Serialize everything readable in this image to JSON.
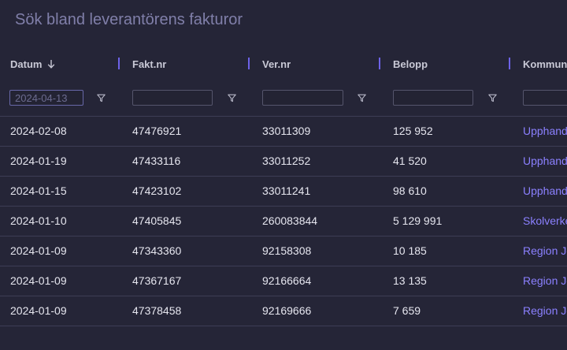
{
  "search": {
    "title": "Sök bland leverantörens fakturor"
  },
  "columns": [
    {
      "label": "Datum",
      "sorted": "descending"
    },
    {
      "label": "Fakt.nr"
    },
    {
      "label": "Ver.nr"
    },
    {
      "label": "Belopp"
    },
    {
      "label": "Kommun"
    }
  ],
  "filters": {
    "datum_value": "2024-04-13",
    "faktnr_value": "",
    "vernr_value": "",
    "belopp_value": "",
    "kommun_value": ""
  },
  "rows": [
    {
      "datum": "2024-02-08",
      "faktnr": "47476921",
      "vernr": "33011309",
      "belopp": "125 952",
      "kommun": "Upphandlingsmyndigheten"
    },
    {
      "datum": "2024-01-19",
      "faktnr": "47433116",
      "vernr": "33011252",
      "belopp": "41 520",
      "kommun": "Upphandlingsmyndigheten"
    },
    {
      "datum": "2024-01-15",
      "faktnr": "47423102",
      "vernr": "33011241",
      "belopp": "98 610",
      "kommun": "Upphandlingsmyndigheten"
    },
    {
      "datum": "2024-01-10",
      "faktnr": "47405845",
      "vernr": "260083844",
      "belopp": "5 129 991",
      "kommun": "Skolverket"
    },
    {
      "datum": "2024-01-09",
      "faktnr": "47343360",
      "vernr": "92158308",
      "belopp": "10 185",
      "kommun": "Region Jönköpings län"
    },
    {
      "datum": "2024-01-09",
      "faktnr": "47367167",
      "vernr": "92166664",
      "belopp": "13 135",
      "kommun": "Region Jönköpings län"
    },
    {
      "datum": "2024-01-09",
      "faktnr": "47378458",
      "vernr": "92169666",
      "belopp": "7 659",
      "kommun": "Region Jönköpings län"
    }
  ],
  "colors": {
    "background": "#252537",
    "accent": "#6d62e8",
    "link": "#8b80ff",
    "text": "#e6e6ef"
  }
}
